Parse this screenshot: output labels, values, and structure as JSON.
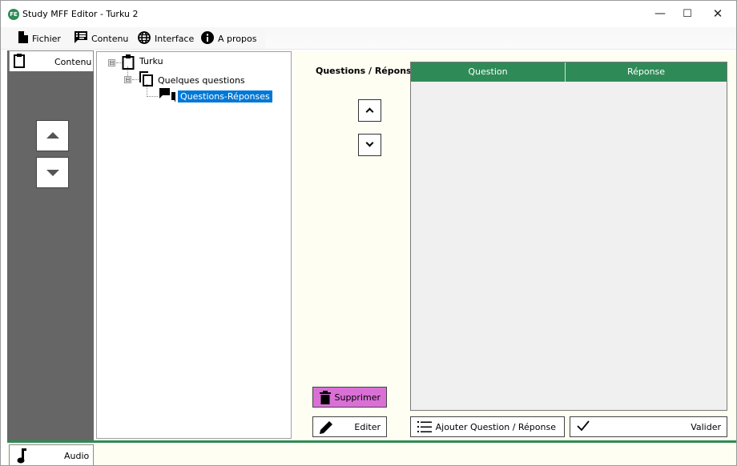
{
  "window": {
    "title": "Study MFF Editor - Turku 2",
    "app_icon_text": "FE"
  },
  "window_controls": {
    "minimize": "—",
    "maximize": "☐",
    "close": "✕"
  },
  "menu": {
    "items": [
      {
        "label": "Fichier",
        "icon": "file-icon"
      },
      {
        "label": "Contenu",
        "icon": "list-icon"
      },
      {
        "label": "Interface",
        "icon": "globe-icon"
      },
      {
        "label": "A propos",
        "icon": "info-icon"
      }
    ]
  },
  "sidebar": {
    "tab_top": {
      "label": "Contenu",
      "icon": "clipboard-icon"
    },
    "tab_bottom": {
      "label": "Audio",
      "icon": "music-note-icon"
    }
  },
  "tree": {
    "nodes": [
      {
        "label": "Turku",
        "icon": "clipboard-icon",
        "expander": "⊟"
      },
      {
        "label": "Quelques questions",
        "icon": "copy-icon",
        "expander": "⊟"
      },
      {
        "label": "Questions-Réponses",
        "icon": "chat-icon",
        "selected": true
      }
    ]
  },
  "editor": {
    "section_label": "Questions / Réponses :",
    "table": {
      "columns": [
        "Question",
        "Réponse"
      ],
      "rows": []
    },
    "buttons": {
      "supprimer": "Supprimer",
      "editer": "Editer",
      "ajouter": "Ajouter Question / Réponse",
      "valider": "Valider"
    }
  },
  "colors": {
    "accent_green": "#2e8b57",
    "delete_button": "#da70d6",
    "selection_blue": "#0078d7",
    "sidebar_dark": "#666666",
    "panel_cream": "#fefef2"
  }
}
